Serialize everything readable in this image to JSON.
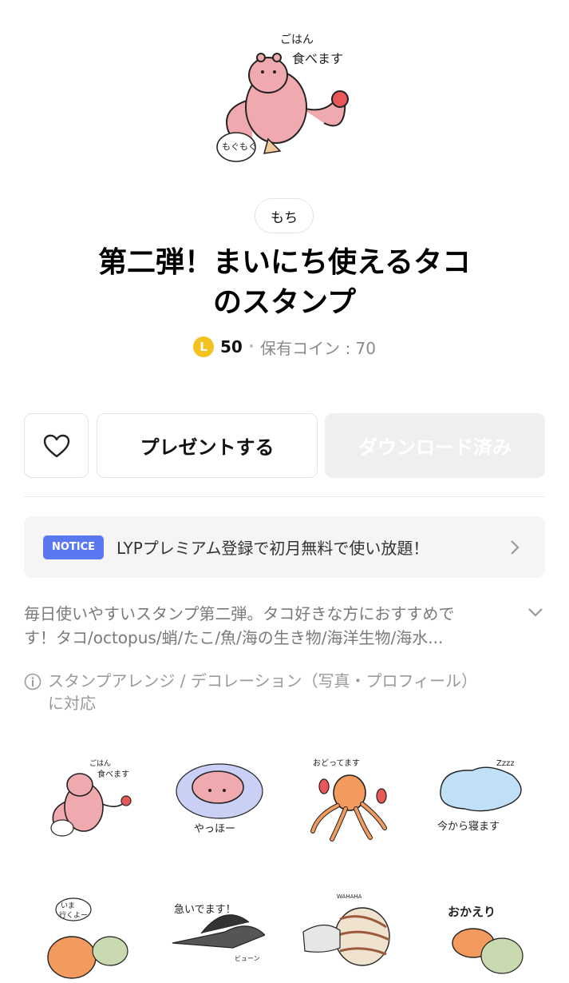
{
  "package": {
    "author": "もち",
    "title_line1": "第二弾！まいにち使えるタコ",
    "title_line2": "のスタンプ",
    "coin_symbol": "L",
    "price": "50",
    "separator": "•",
    "owned_coins": "保有コイン : 70"
  },
  "actions": {
    "favorite_icon": "heart-icon",
    "present_label": "プレゼントする",
    "download_label": "ダウンロード済み"
  },
  "notice": {
    "badge": "NOTICE",
    "text": "LYPプレミアム登録で初月無料で使い放題！",
    "chevron_icon": "chevron-right-icon"
  },
  "description": {
    "line1": "毎日使いやすいスタンプ第二弾。タコ好きな方におすすめで",
    "line2": "す！タコ/octopus/蛸/たこ/魚/海の生き物/海洋生物/海水...",
    "toggle_icon": "chevron-down-icon"
  },
  "features": {
    "info_icon": "info-icon",
    "line1": "スタンプアレンジ / デコレーション（写真・プロフィール）",
    "line2": "に対応"
  },
  "hero_sticker": {
    "text_top": "ごはん",
    "text_main": "食べます",
    "text_side": "もぐもぐ"
  },
  "stickers": [
    {
      "text1": "ごはん",
      "text2": "食べます"
    },
    {
      "text1": "やっほー",
      "text2": ""
    },
    {
      "text1": "おどってます",
      "text2": ""
    },
    {
      "text1": "今から寝ます",
      "text2": "Zzzz"
    },
    {
      "text1": "いま",
      "text2": "行くよー"
    },
    {
      "text1": "急いでます！",
      "text2": "ビューン"
    },
    {
      "text1": "WAHAHA",
      "text2": ""
    },
    {
      "text1": "おかえり",
      "text2": ""
    }
  ],
  "colors": {
    "octopus_pink": "#f0a9ae",
    "octopus_orange": "#f39a5e",
    "notice_blue": "#5a79f0",
    "coin_gold": "#f3c21f"
  }
}
